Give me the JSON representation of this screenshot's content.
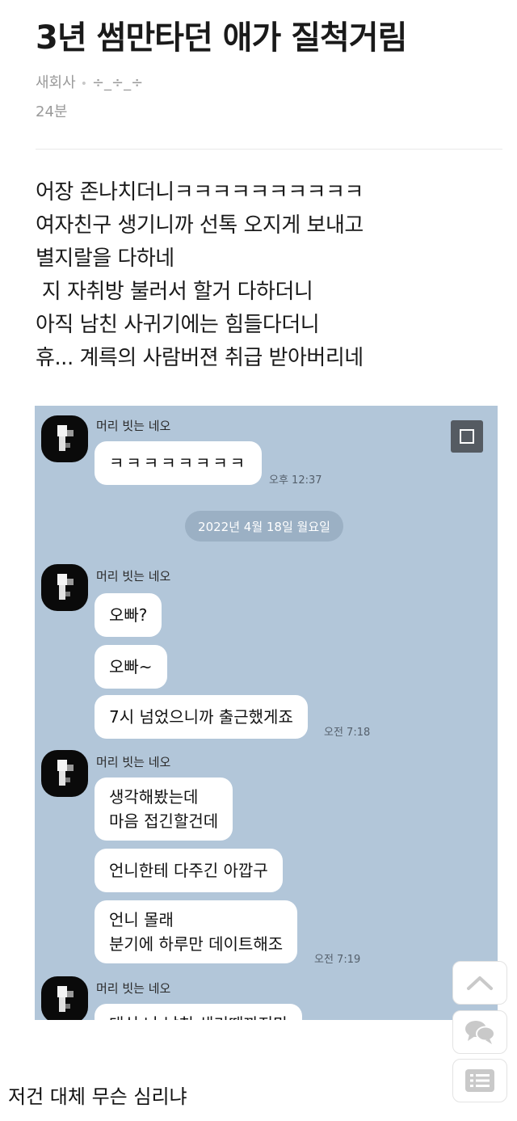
{
  "post": {
    "title": "3년 썸만타던 애가 질척거림",
    "category": "새회사",
    "author": "÷_÷_÷",
    "time": "24분",
    "body_lines": [
      "어장 존나치더니ㅋㅋㅋㅋㅋㅋㅋㅋㅋㅋ",
      "여자친구 생기니까 선톡 오지게 보내고",
      "별지랄을 다하네",
      " 지 자취방 불러서 할거 다하더니",
      "아직 남친 사귀기에는 힘들다더니",
      "휴... 계륵의 사람버젼 취급 받아버리네"
    ]
  },
  "chat": {
    "background": "#b2c6d9",
    "sender": "머리 빗는 네오",
    "date_divider": "2022년 4월 18일 월요일",
    "groups": [
      {
        "messages": [
          "ㅋㅋㅋㅋㅋㅋㅋㅋ"
        ],
        "time": "오후 12:37"
      },
      {
        "messages": [
          "오빠?",
          "오빠~",
          "7시 넘었으니까 출근했게죠"
        ],
        "time": "오전 7:18"
      },
      {
        "messages": [
          [
            "생각해봤는데",
            "마음 접긴할건데"
          ],
          "언니한테 다주긴 아깝구",
          [
            "언니 몰래",
            "분기에 하루만 데이트해조"
          ]
        ],
        "time": "오전 7:19"
      },
      {
        "messages": [
          "대신 나 남친 생기때까지만"
        ],
        "time": ""
      }
    ]
  },
  "comment": "저건 대체 무슨 심리냐",
  "side_buttons": [
    {
      "icon": "chevron-up-icon"
    },
    {
      "icon": "chat-bubbles-icon"
    },
    {
      "icon": "list-icon"
    }
  ]
}
